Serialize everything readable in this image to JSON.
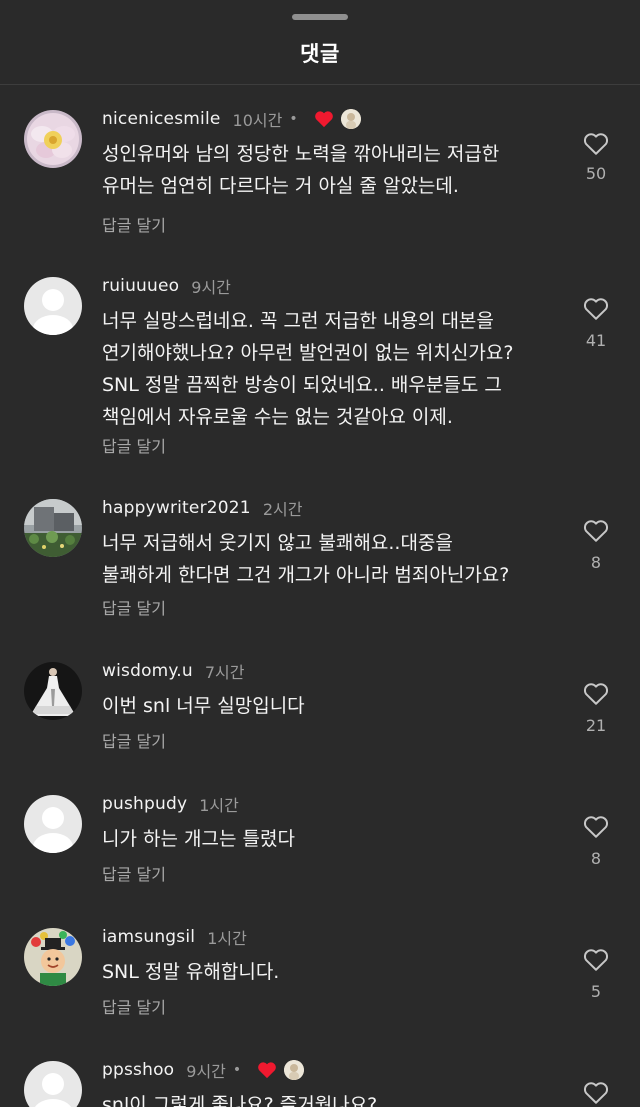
{
  "header": {
    "title": "댓글"
  },
  "comments": [
    {
      "username": "nicenicesmile",
      "time": "10시간",
      "author_liked": true,
      "text": "성인유머와 남의 정당한 노력을 깎아내리는 저급한\n유머는 엄연히 다르다는 거 아실 줄 알았는데.",
      "reply_label": "답글 달기",
      "likes": "50",
      "avatar": "flower"
    },
    {
      "username": "ruiuuueo",
      "time": "9시간",
      "author_liked": false,
      "text": "너무 실망스럽네요. 꼭 그런 저급한 내용의 대본을\n연기해야했나요? 아무런 발언권이 없는 위치신가요?\nSNL 정말 끔찍한 방송이 되었네요.. 배우분들도 그\n책임에서 자유로울 수는 없는 것같아요 이제.",
      "reply_label": "답글 달기",
      "likes": "41",
      "avatar": "default"
    },
    {
      "username": "happywriter2021",
      "time": "2시간",
      "author_liked": false,
      "text": "너무 저급해서 웃기지 않고 불쾌해요..대중을\n불쾌하게 한다면 그건 개그가 아니라 범죄아닌가요?",
      "reply_label": "답글 달기",
      "likes": "8",
      "avatar": "garden"
    },
    {
      "username": "wisdomy.u",
      "time": "7시간",
      "author_liked": false,
      "text": "이번 snl 너무 실망입니다",
      "reply_label": "답글 달기",
      "likes": "21",
      "avatar": "dress"
    },
    {
      "username": "pushpudy",
      "time": "1시간",
      "author_liked": false,
      "text": "니가 하는 개그는 틀렸다",
      "reply_label": "답글 달기",
      "likes": "8",
      "avatar": "default"
    },
    {
      "username": "iamsungsil",
      "time": "1시간",
      "author_liked": false,
      "text": "SNL 정말 유해합니다.",
      "reply_label": "답글 달기",
      "likes": "5",
      "avatar": "cartoon"
    },
    {
      "username": "ppsshoo",
      "time": "9시간",
      "author_liked": true,
      "text": "snl이 그렇게 좋나요? 즐거웠나요?",
      "reply_label": "",
      "likes": "",
      "avatar": "default"
    }
  ],
  "icons": {
    "like": "heart-outline-icon",
    "author_like": "heart-filled-icon"
  },
  "colors": {
    "background": "#2a2a2a",
    "heart_red": "#f0192f",
    "secondary_text": "#9a9a9a"
  }
}
